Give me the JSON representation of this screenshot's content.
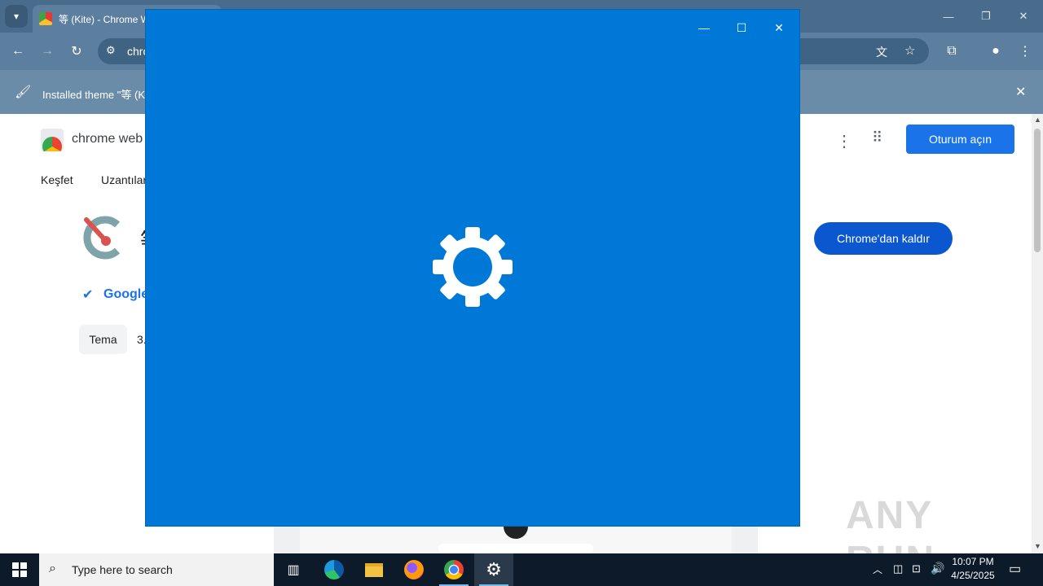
{
  "browser": {
    "tab_title": "等 (Kite) - Chrome W",
    "address_partial": "chro",
    "infobar_text": "Installed theme \"等 (K",
    "window_controls": {
      "minimize": "—",
      "restore": "❐",
      "close": "✕"
    }
  },
  "store": {
    "brand_partial": "chrome web",
    "nav": [
      "Keşfet",
      "Uzantılar"
    ],
    "signin_label": "Oturum açın",
    "remove_label": "Chrome'dan kaldır",
    "publisher_partial": "Google",
    "item_title_partial": "等",
    "tag_label": "Tema",
    "rating_partial": "3."
  },
  "dialog": {
    "controls": {
      "minimize": "—",
      "maximize": "☐",
      "close": "✕"
    },
    "icon": "gear-icon",
    "background": "#0078d7"
  },
  "taskbar": {
    "search_placeholder": "Type here to search",
    "time": "10:07 PM",
    "date": "4/25/2025",
    "apps": [
      "task-view-icon",
      "edge-icon",
      "file-explorer-icon",
      "firefox-icon",
      "chrome-icon",
      "settings-icon"
    ]
  },
  "watermark": "ANY RUN"
}
